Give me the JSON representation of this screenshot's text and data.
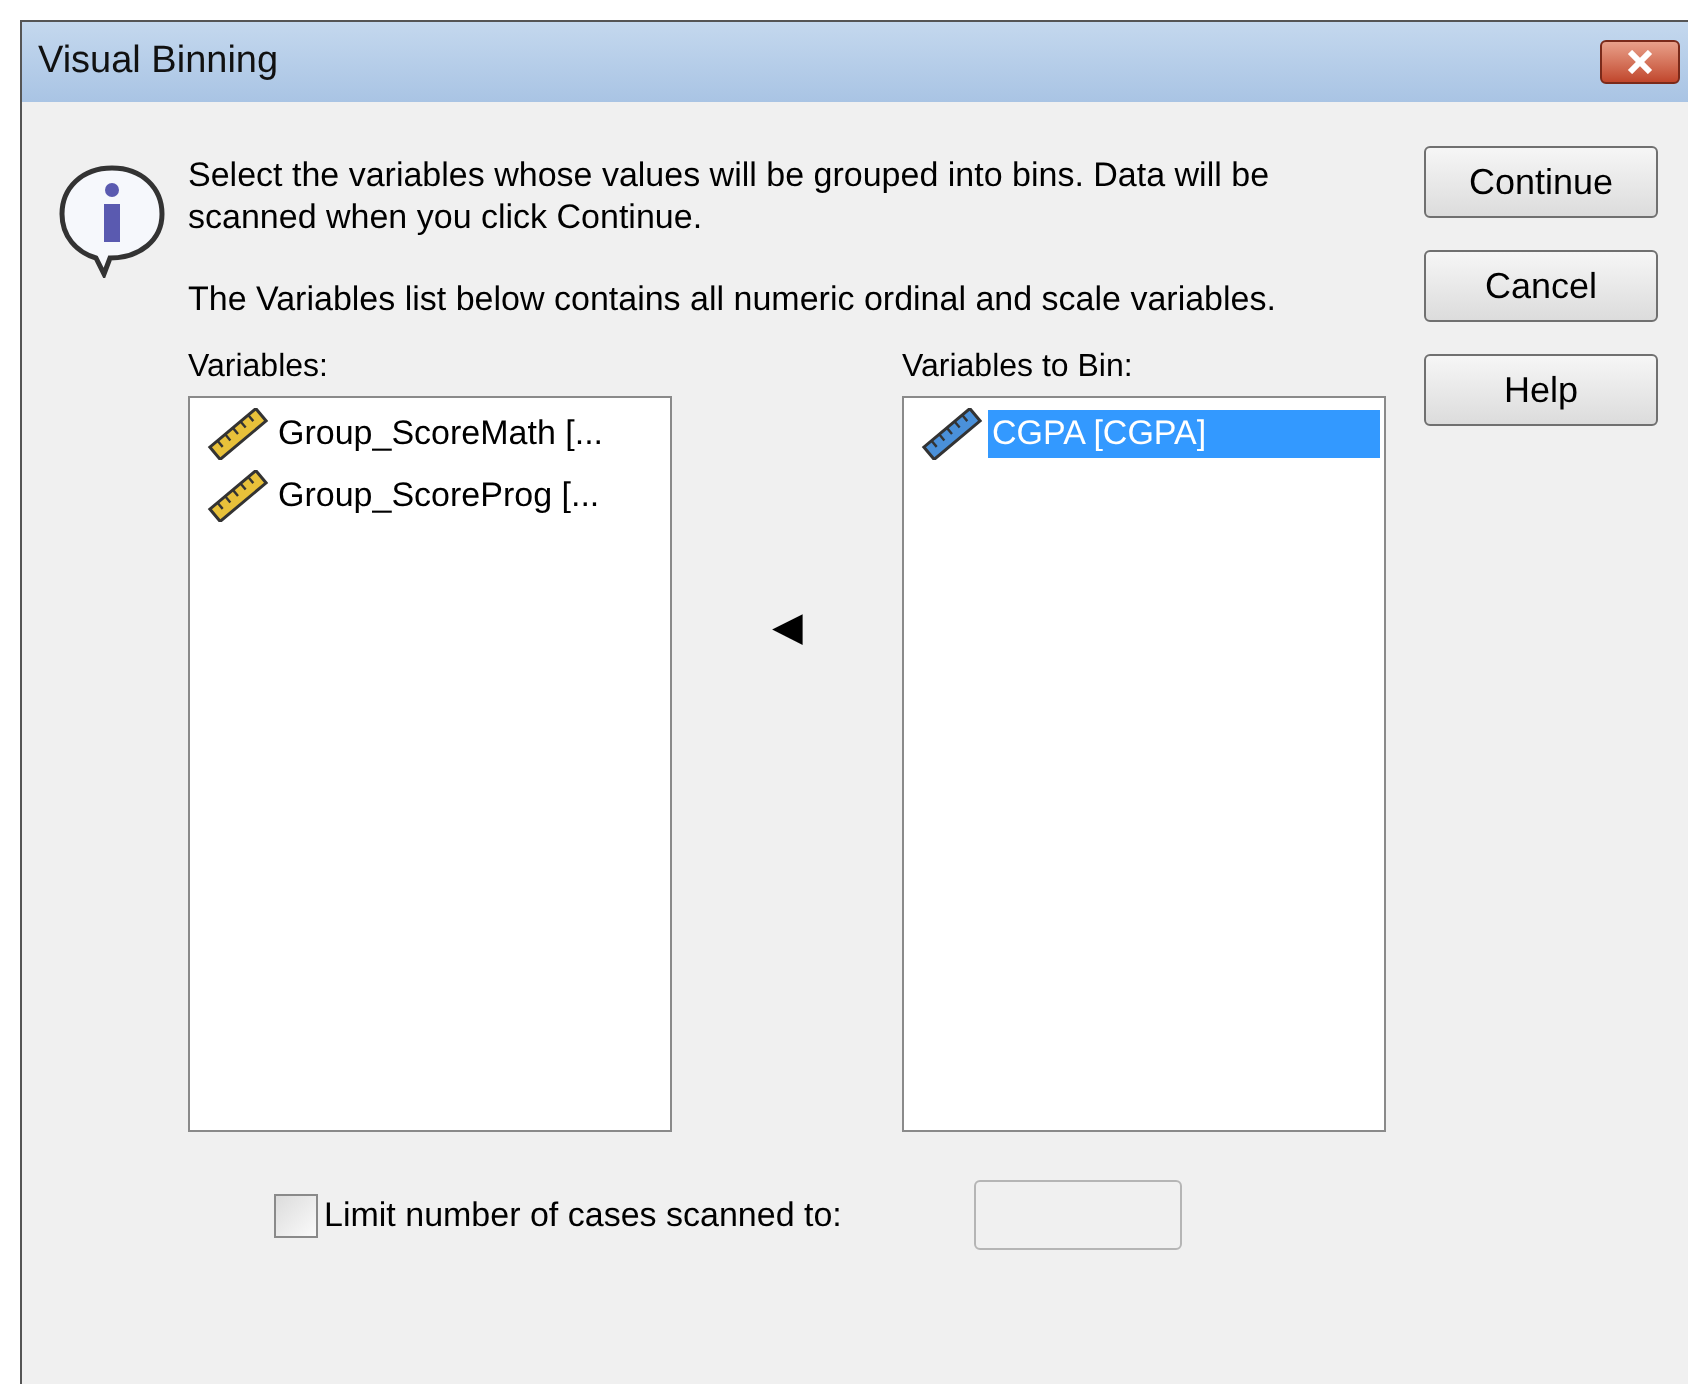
{
  "window": {
    "title": "Visual Binning"
  },
  "instructions": [
    "Select the variables whose values will be grouped into bins.  Data will be scanned when you click Continue.",
    "The Variables list below contains all numeric ordinal and scale variables."
  ],
  "buttons": [
    "Continue",
    "Cancel",
    "Help"
  ],
  "source_list": {
    "label": "Variables:",
    "items": [
      {
        "name": "Group_ScoreMath [...",
        "selected": false
      },
      {
        "name": "Group_ScoreProg [...",
        "selected": false
      }
    ]
  },
  "move_button": {
    "symbol": "◀"
  },
  "target_list": {
    "label": "Variables to Bin:",
    "items": [
      {
        "name": "CGPA [CGPA]",
        "selected": true
      }
    ]
  },
  "limit": {
    "label": "Limit number of cases scanned to:",
    "checked": false,
    "disabled": true
  }
}
